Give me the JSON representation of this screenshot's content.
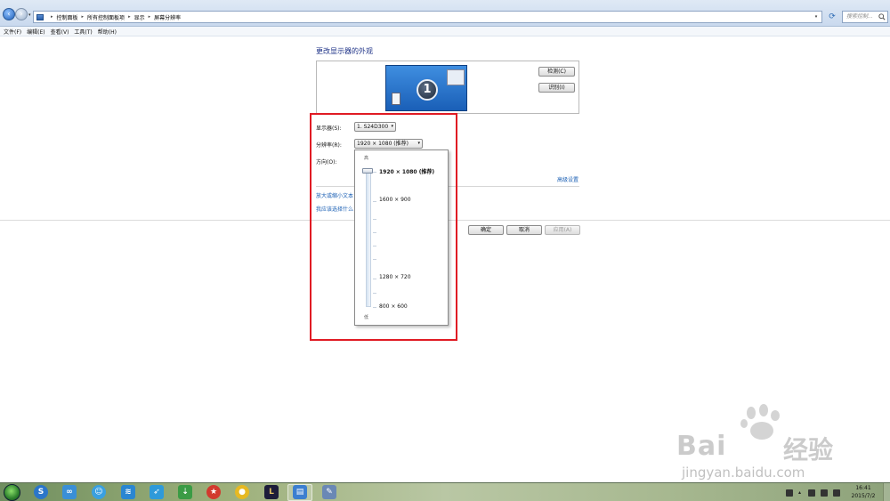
{
  "address_bar": {
    "breadcrumbs": [
      "控制面板",
      "所有控制面板项",
      "显示",
      "屏幕分辨率"
    ],
    "search_placeholder": "搜索控制..."
  },
  "menu": {
    "items": [
      "文件(F)",
      "编辑(E)",
      "查看(V)",
      "工具(T)",
      "帮助(H)"
    ]
  },
  "main": {
    "title": "更改显示器的外观",
    "monitor_number": "1",
    "detect_label": "检测(C)",
    "identify_label": "识别(I)",
    "display_label": "显示器(S):",
    "display_value": "1. S24D300",
    "resolution_label": "分辨率(R):",
    "resolution_value": "1920 × 1080 (推荐)",
    "orientation_label": "方向(O):",
    "advanced_link": "高级设置",
    "enlarge_link": "放大或缩小文本",
    "which_link": "我应该选择什么",
    "ok_label": "确定",
    "cancel_label": "取消",
    "apply_label": "应用(A)"
  },
  "resolution_dropdown": {
    "high_label": "高",
    "low_label": "低",
    "options": [
      "1920 × 1080 (推荐)",
      "1600 × 900",
      "1280 × 720",
      "800 × 600"
    ],
    "selected_index": 0
  },
  "annotation": {
    "color": "#e01b24"
  },
  "watermark": {
    "brand": "Bai",
    "brand_cn": "经验",
    "url": "jingyan.baidu.com"
  },
  "taskbar": {
    "time": "16:41",
    "date": "2015/7/2"
  }
}
